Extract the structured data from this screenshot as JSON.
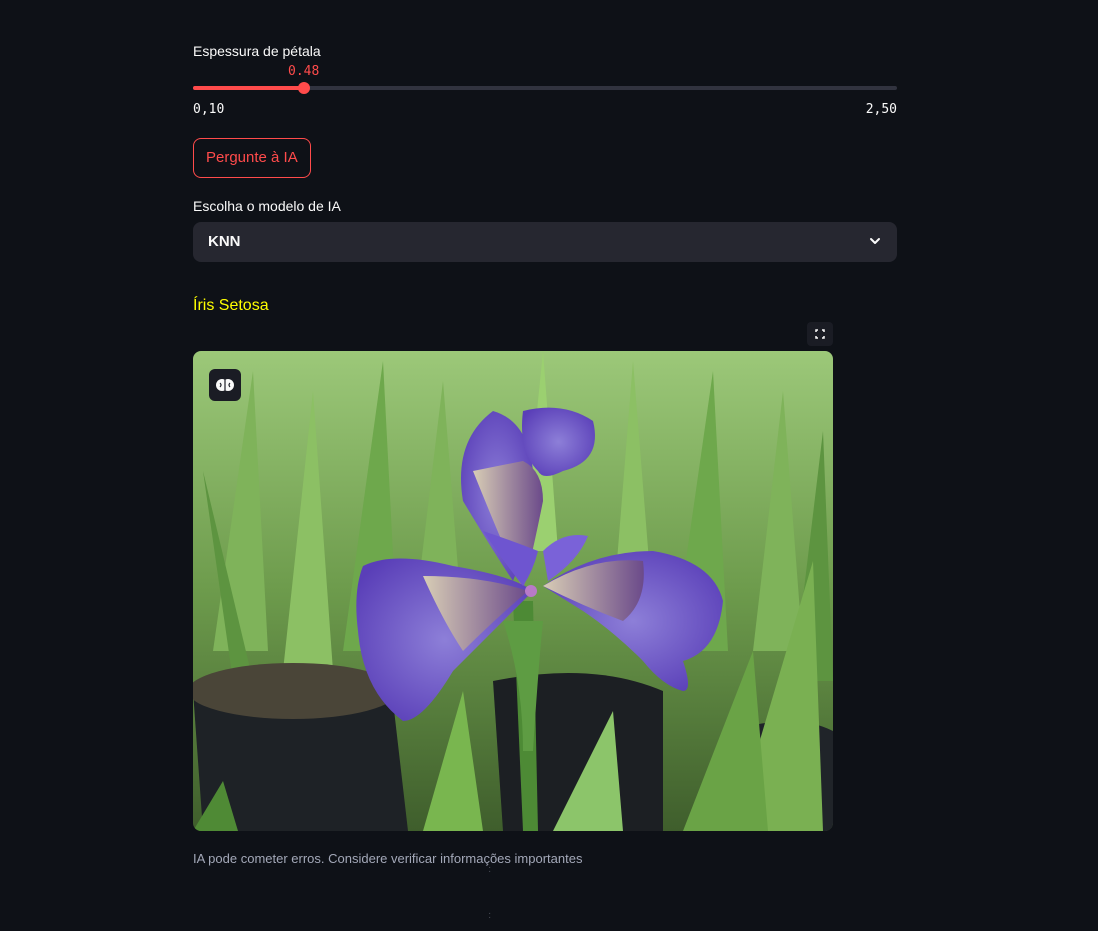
{
  "slider": {
    "label": "Espessura de pétala",
    "value": "0.48",
    "min_label": "0,10",
    "max_label": "2,50",
    "fraction": 0.158
  },
  "ask_button": {
    "label": "Pergunte à IA"
  },
  "model_select": {
    "label": "Escolha o modelo de IA",
    "selected": "KNN"
  },
  "result": {
    "title": "Íris Setosa",
    "image_icon": "brain-icon",
    "fullscreen_icon": "fullscreen-icon"
  },
  "disclaimer": "IA pode cometer erros. Considere verificar informações importantes",
  "colors": {
    "accent": "#ff4b4b",
    "background": "#0e1117",
    "result_title": "#ffff00",
    "input_bg": "#262730"
  }
}
